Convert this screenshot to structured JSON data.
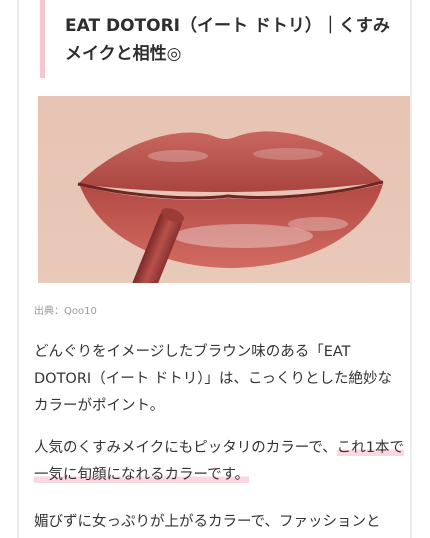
{
  "article": {
    "heading": "EAT DOTORI（イート ドトリ）｜くすみメイクと相性◎",
    "image_caption": "出典：Qoo10",
    "paragraph1": "どんぐりをイメージしたブラウン味のある「EAT DOTORI（イート ドトリ）」は、こっくりとした絶妙なカラーがポイント。",
    "paragraph2_lead": "人気のくすみメイクにもピッタリのカラーで、",
    "paragraph2_highlight": "これ1本で一気に旬顔になれるカラーです。",
    "paragraph3": "媚びずに女っぷりが上がるカラーで、ファッションと"
  },
  "colors": {
    "heading_accent": "#f7c5cf",
    "highlight": "#fbd7e0",
    "lip": "#c0504b"
  }
}
